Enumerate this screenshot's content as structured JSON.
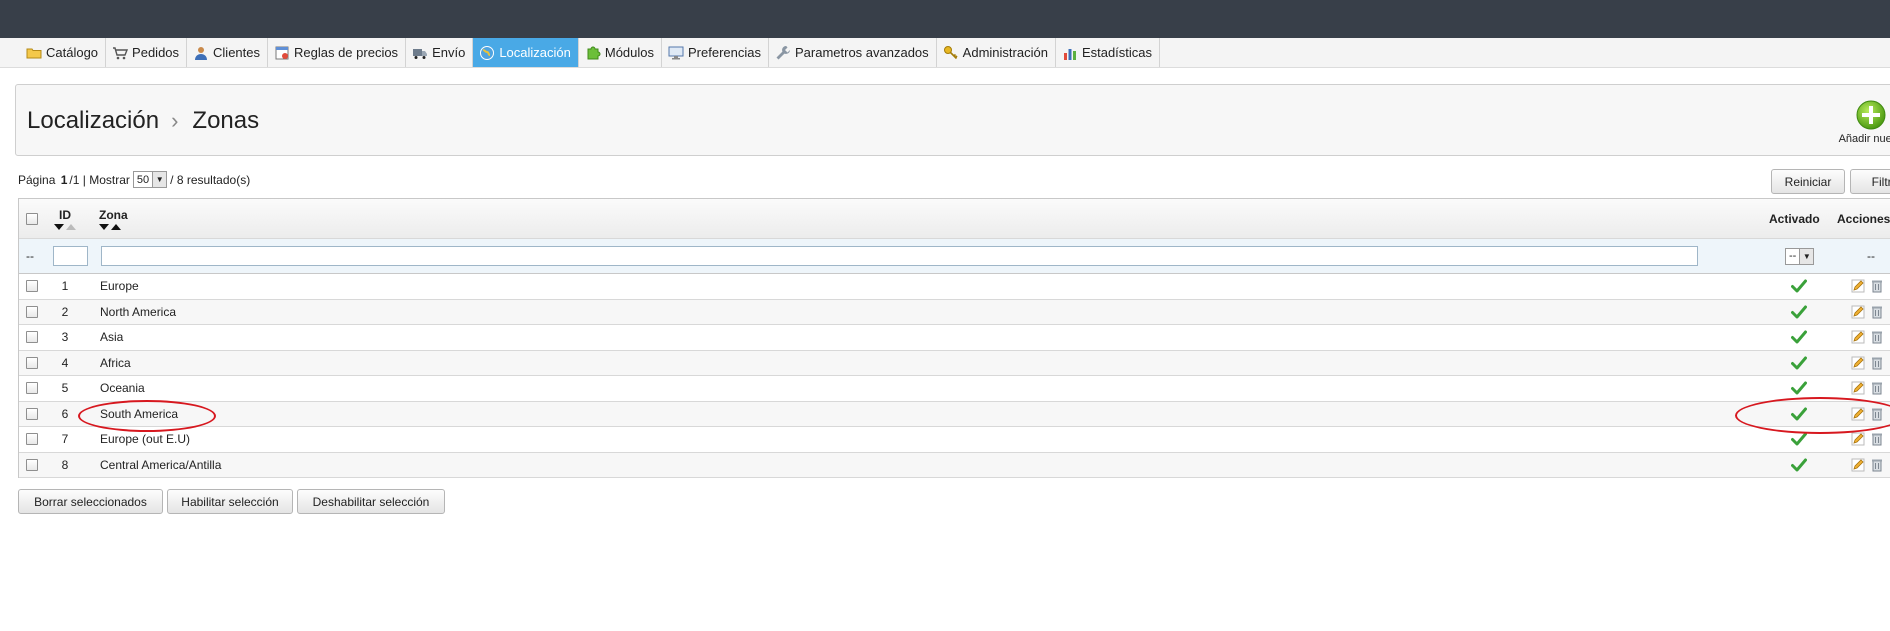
{
  "menu": [
    {
      "label": "Catálogo",
      "icon": "folder-icon",
      "name": "menu-catalogo"
    },
    {
      "label": "Pedidos",
      "icon": "cart-icon",
      "name": "menu-pedidos"
    },
    {
      "label": "Clientes",
      "icon": "user-icon",
      "name": "menu-clientes"
    },
    {
      "label": "Reglas de precios",
      "icon": "price-rules-icon",
      "name": "menu-reglas-precios"
    },
    {
      "label": "Envío",
      "icon": "truck-icon",
      "name": "menu-envio"
    },
    {
      "label": "Localización",
      "icon": "globe-icon",
      "name": "menu-localizacion",
      "active": true
    },
    {
      "label": "Módulos",
      "icon": "puzzle-icon",
      "name": "menu-modulos"
    },
    {
      "label": "Preferencias",
      "icon": "monitor-icon",
      "name": "menu-preferencias"
    },
    {
      "label": "Parametros avanzados",
      "icon": "wrench-icon",
      "name": "menu-parametros-avanzados"
    },
    {
      "label": "Administración",
      "icon": "key-icon",
      "name": "menu-administracion"
    },
    {
      "label": "Estadísticas",
      "icon": "bar-chart-icon",
      "name": "menu-estadisticas"
    }
  ],
  "breadcrumb": {
    "parent": "Localización",
    "separator": "›",
    "current": "Zonas"
  },
  "add_new_label": "Añadir nuevo",
  "pager": {
    "page_word": "Página",
    "page": "1",
    "total": "1",
    "show_word": "Mostrar",
    "per_page": "50",
    "results": "8 resultado(s)"
  },
  "buttons": {
    "reset": "Reiniciar",
    "filter": "Filtrar"
  },
  "columns": {
    "id": "ID",
    "zone": "Zona",
    "enabled": "Activado",
    "actions": "Acciones"
  },
  "filter_row": {
    "bulk": "--",
    "enabled_select": "--",
    "actions": "--"
  },
  "rows": [
    {
      "id": "1",
      "zone": "Europe"
    },
    {
      "id": "2",
      "zone": "North America"
    },
    {
      "id": "3",
      "zone": "Asia"
    },
    {
      "id": "4",
      "zone": "Africa"
    },
    {
      "id": "5",
      "zone": "Oceania"
    },
    {
      "id": "6",
      "zone": "South America"
    },
    {
      "id": "7",
      "zone": "Europe (out E.U)"
    },
    {
      "id": "8",
      "zone": "Central America/Antilla"
    }
  ],
  "bulk_actions": {
    "delete": "Borrar seleccionados",
    "enable": "Habilitar selección",
    "disable": "Deshabilitar selección"
  },
  "colors": {
    "topbar": "#383f49",
    "active_tab": "#49a9e6",
    "check": "#3aa13a",
    "annotation": "#d7181f"
  }
}
